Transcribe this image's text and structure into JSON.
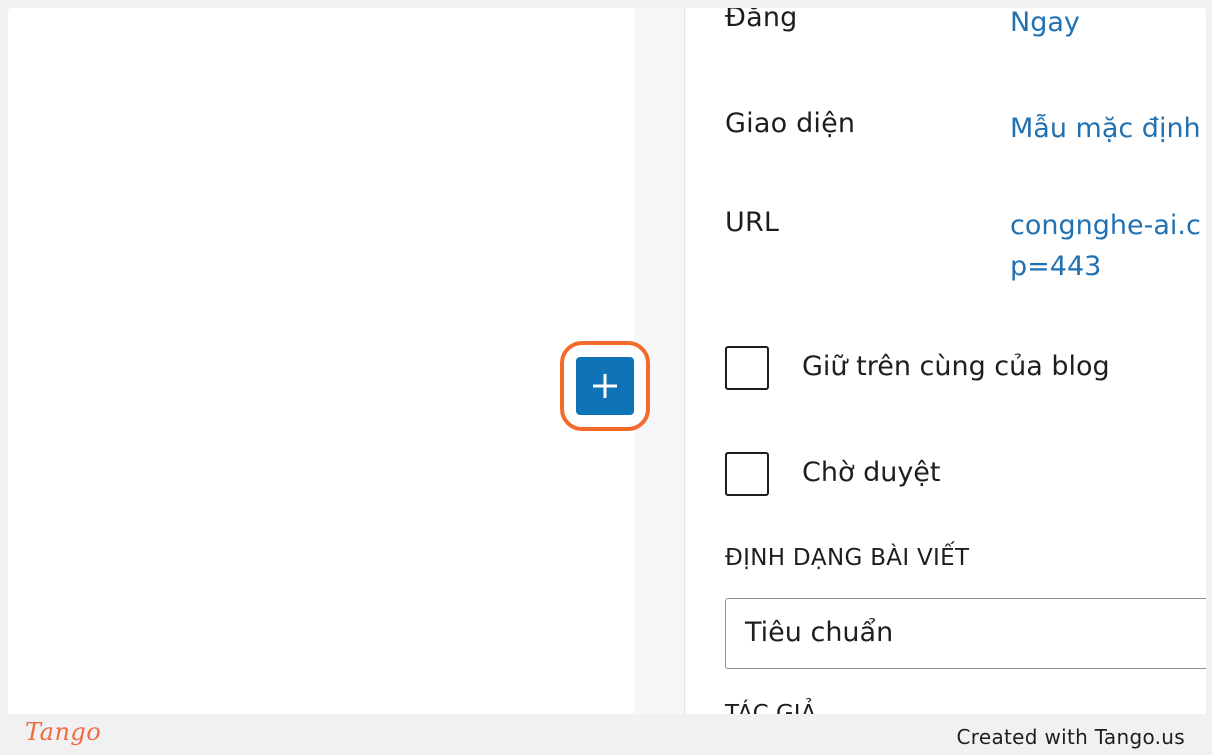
{
  "sidebar": {
    "publish_label": "Đăng",
    "publish_value": "Ngay",
    "template_label": "Giao diện",
    "template_value": "Mẫu mặc định",
    "url_label": "URL",
    "url_value_line1": "congnghe-ai.c",
    "url_value_line2": "p=443",
    "sticky_label": "Giữ trên cùng của blog",
    "pending_label": "Chờ duyệt",
    "format_section_title": "ĐỊNH DẠNG BÀI VIẾT",
    "format_selected": "Tiêu chuẩn",
    "next_section_partial": "TÁC GIẢ"
  },
  "editor": {
    "add_block_icon": "plus-icon"
  },
  "footer": {
    "logo_text": "Tango",
    "credit_text": "Created with Tango.us"
  },
  "colors": {
    "accent": "#0f73b8",
    "link": "#2271b1",
    "highlight": "#f26b2a",
    "logo": "#f06b3f"
  }
}
